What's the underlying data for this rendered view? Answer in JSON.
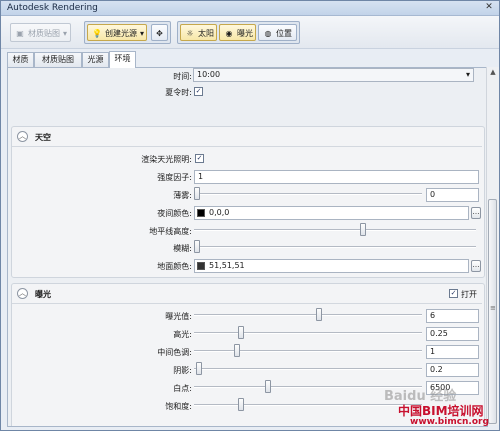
{
  "window": {
    "title": "Autodesk Rendering"
  },
  "toolbar": {
    "material_map_label": "材质贴图",
    "create_light_label": "创建光源",
    "sun_label": "太阳",
    "exposure_label": "曝光",
    "location_label": "位置"
  },
  "tabs": [
    "材质",
    "材质贴图",
    "光源",
    "环境"
  ],
  "time_section": {
    "time_label": "时间:",
    "time_value": "10:00",
    "dst_label": "夏令时:",
    "dst_checked": "✓"
  },
  "sky": {
    "title": "天空",
    "render_sky_label": "渲染天光照明:",
    "render_sky_checked": "✓",
    "intensity_label": "强度因子:",
    "intensity_value": "1",
    "haze_label": "薄雾:",
    "haze_value": "0",
    "night_color_label": "夜间颜色:",
    "night_color_value": "0,0,0",
    "horizon_label": "地平线高度:",
    "blur_label": "模糊:",
    "ground_color_label": "地面颜色:",
    "ground_color_value": "51,51,51"
  },
  "exposure": {
    "title": "曝光",
    "enable_label": "打开",
    "enable_checked": "✓",
    "exposure_value_label": "曝光值:",
    "exposure_value": "6",
    "highlights_label": "高光:",
    "highlights_value": "0.25",
    "midtones_label": "中间色调:",
    "midtones_value": "1",
    "shadows_label": "阴影:",
    "shadows_value": "0.2",
    "whitepoint_label": "白点:",
    "whitepoint_value": "6500",
    "saturation_label": "饱和度:"
  },
  "sliders": {
    "haze": 0.0,
    "horizon": 0.6,
    "blur": 0.0,
    "exposure": 0.55,
    "highlights": 0.2,
    "midtones": 0.18,
    "shadows": 0.01,
    "whitepoint": 0.32,
    "saturation": 0.2
  },
  "watermarks": {
    "baidu": "Baidu 经验",
    "bim_cn": "中国BIM培训网",
    "bim_url": "www.bimcn.org"
  },
  "colors": {
    "night_color": "#000000",
    "ground_color": "#333333",
    "bim_red": "#c8102e"
  }
}
